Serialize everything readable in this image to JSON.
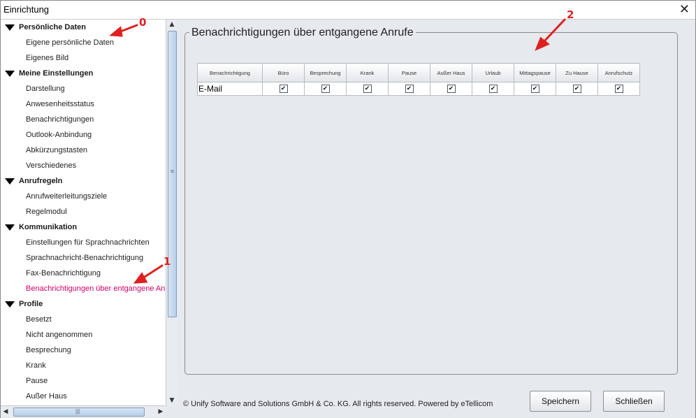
{
  "window": {
    "title": "Einrichtung",
    "close_glyph": "✕"
  },
  "tree": {
    "categories": [
      {
        "label": "Persönliche Daten",
        "children": [
          "Eigene persönliche Daten",
          "Eigenes Bild"
        ]
      },
      {
        "label": "Meine Einstellungen",
        "children": [
          "Darstellung",
          "Anwesenheitsstatus",
          "Benachrichtigungen",
          "Outlook-Anbindung",
          "Abkürzungstasten",
          "Verschiedenes"
        ]
      },
      {
        "label": "Anrufregeln",
        "children": [
          "Anrufweiterleitungsziele",
          "Regelmodul"
        ]
      },
      {
        "label": "Kommunikation",
        "children": [
          "Einstellungen für Sprachnachrichten",
          "Sprachnachricht-Benachrichtigung",
          "Fax-Benachrichtigung",
          "Benachrichtigungen über entgangene Anr"
        ]
      },
      {
        "label": "Profile",
        "children": [
          "Besetzt",
          "Nicht angenommen",
          "Besprechung",
          "Krank",
          "Pause",
          "Außer Haus"
        ]
      }
    ],
    "selected": "Benachrichtigungen über entgangene Anr"
  },
  "panel": {
    "title": "Benachrichtigungen über entgangene Anrufe",
    "table": {
      "headers": [
        "Benachrichtigung",
        "Büro",
        "Besprechung",
        "Krank",
        "Pause",
        "Außer Haus",
        "Urlaub",
        "Mittagspause",
        "Zu Hause",
        "Anrufschutz"
      ],
      "rows": [
        {
          "label": "E-Mail",
          "checked": [
            true,
            true,
            true,
            true,
            true,
            true,
            true,
            true,
            true
          ]
        }
      ]
    }
  },
  "footer": {
    "copyright": "© Unify Software and Solutions GmbH & Co. KG. All rights reserved. Powered by eTellicom"
  },
  "buttons": {
    "save": "Speichern",
    "close": "Schließen"
  },
  "annotations": {
    "a0": "0",
    "a1": "1",
    "a2": "2"
  },
  "colors": {
    "selected_text": "#d4006a",
    "annotation_red": "#e0201e",
    "panel_bg": "#e6e9ed"
  }
}
